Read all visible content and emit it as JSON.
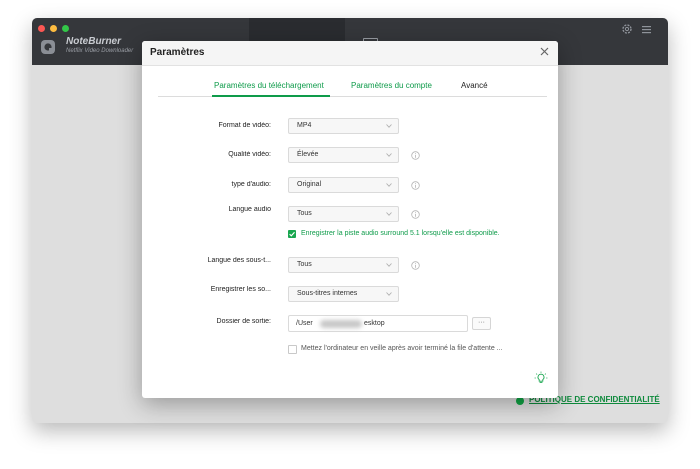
{
  "app": {
    "brand_name": "NoteBurner",
    "brand_sub": "Netflix Video Downloader",
    "privacy_link": "POLITIQUE DE CONFIDENTIALITÉ",
    "accent_color": "#0e9b4a"
  },
  "dialog": {
    "title": "Paramètres",
    "tabs": [
      {
        "label": "Paramètres du téléchargement",
        "active": true
      },
      {
        "label": "Paramètres du compte",
        "active": false
      },
      {
        "label": "Avancé",
        "active": false
      }
    ],
    "fields": {
      "video_format": {
        "label": "Format de vidéo:",
        "value": "MP4"
      },
      "video_quality": {
        "label": "Qualité vidéo:",
        "value": "Élevée"
      },
      "audio_type": {
        "label": "type d'audio:",
        "value": "Original"
      },
      "audio_language": {
        "label": "Langue audio",
        "value": "Tous"
      },
      "subtitle_language": {
        "label": "Langue des sous-t...",
        "value": "Tous"
      },
      "save_subtitles": {
        "label": "Enregistrer les so...",
        "value": "Sous-titres internes"
      },
      "output_folder": {
        "label": "Dossier de sortie:",
        "value_start": "/User",
        "value_end": "esktop",
        "browse_label": "···"
      }
    },
    "surround_checkbox": {
      "label": "Enregistrer la piste audio surround 5.1 lorsqu'elle est disponible.",
      "checked": true
    },
    "sleep_checkbox": {
      "label": "Mettez l'ordinateur en veille après avoir terminé la file d'attente ...",
      "checked": false
    },
    "icons": [
      "close-icon",
      "chevron-down-icon",
      "info-icon",
      "lightbulb-icon"
    ]
  }
}
